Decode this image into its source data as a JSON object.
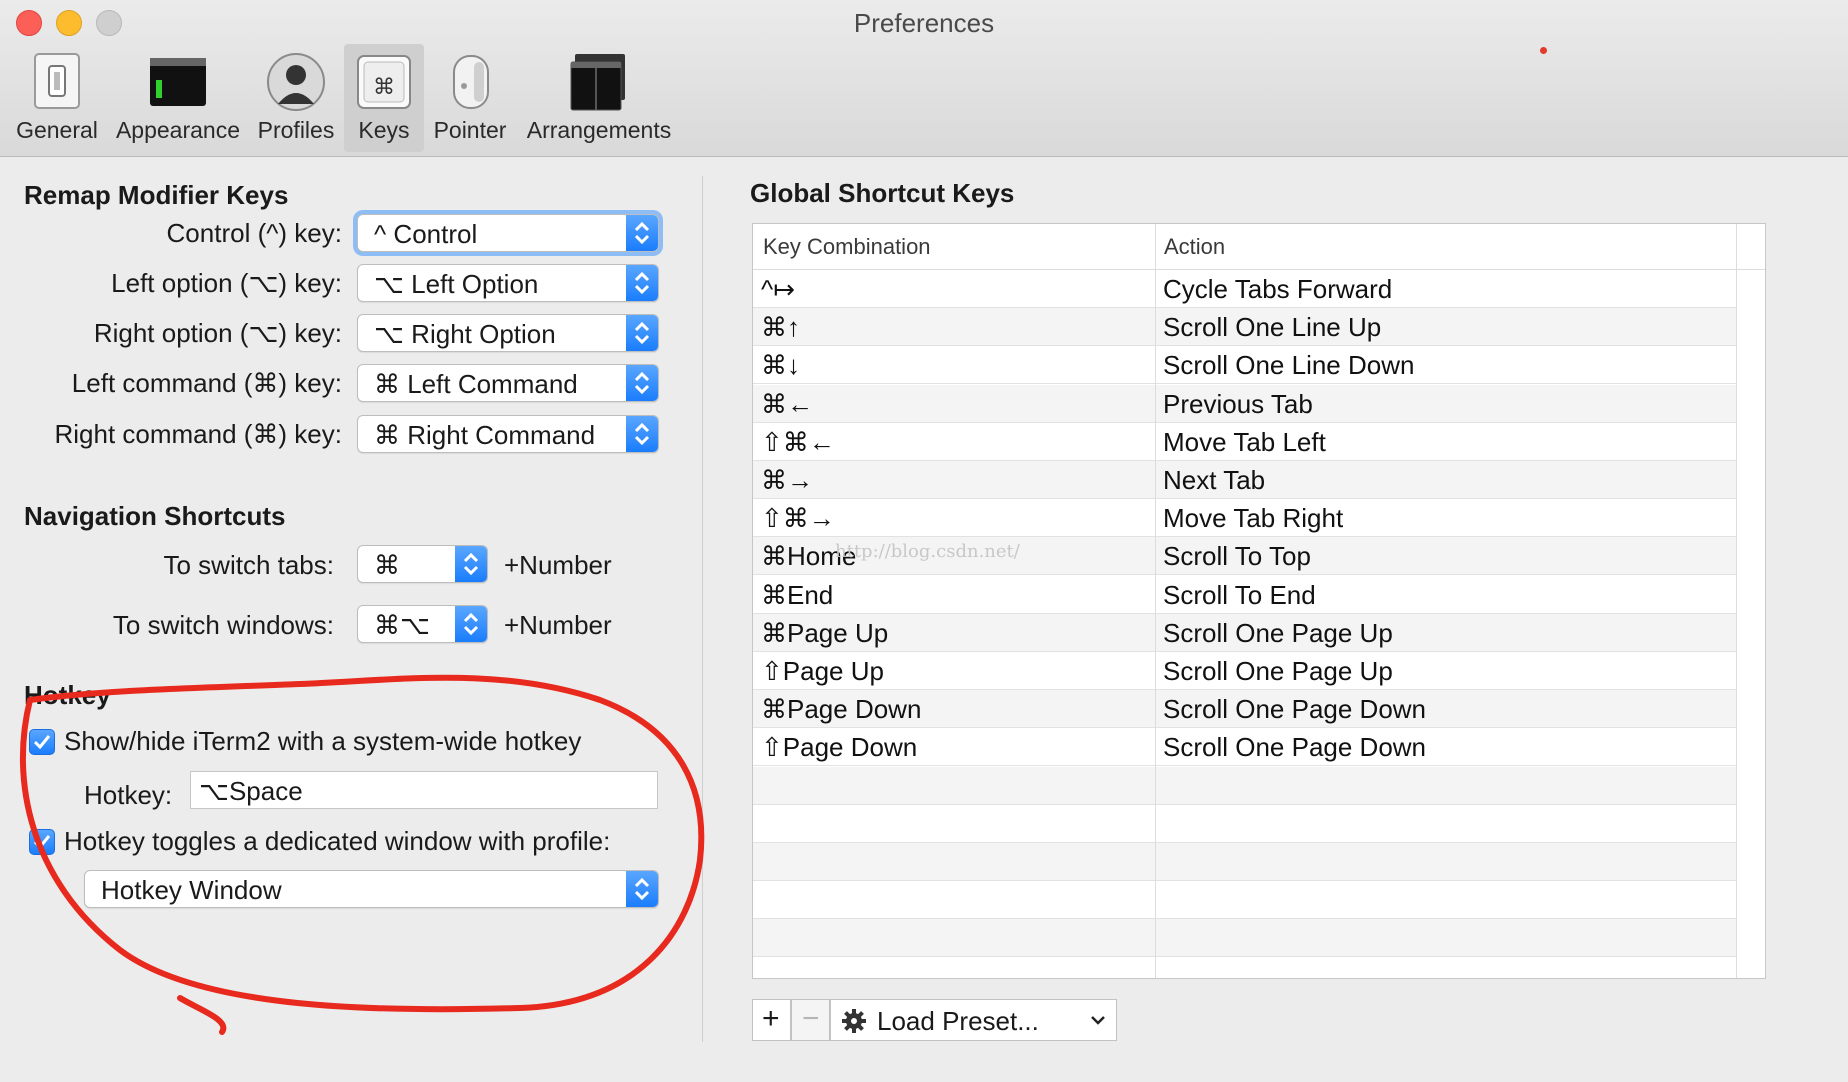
{
  "window": {
    "title": "Preferences"
  },
  "toolbar": {
    "items": [
      {
        "label": "General",
        "icon": "switch-icon"
      },
      {
        "label": "Appearance",
        "icon": "terminal-window-icon"
      },
      {
        "label": "Profiles",
        "icon": "user-icon"
      },
      {
        "label": "Keys",
        "icon": "command-key-icon",
        "selected": true
      },
      {
        "label": "Pointer",
        "icon": "mouse-icon"
      },
      {
        "label": "Arrangements",
        "icon": "windows-icon"
      }
    ]
  },
  "remap": {
    "title": "Remap Modifier Keys",
    "rows": [
      {
        "label": "Control (^) key:",
        "value": "^ Control"
      },
      {
        "label": "Left option (⌥) key:",
        "value": "⌥ Left Option"
      },
      {
        "label": "Right option (⌥) key:",
        "value": "⌥ Right Option"
      },
      {
        "label": "Left command (⌘) key:",
        "value": "⌘ Left Command"
      },
      {
        "label": "Right command (⌘) key:",
        "value": "⌘ Right Command"
      }
    ]
  },
  "navigation": {
    "title": "Navigation Shortcuts",
    "tabs_label": "To switch tabs:",
    "tabs_value": "⌘",
    "windows_label": "To switch windows:",
    "windows_value": "⌘⌥",
    "suffix": "+Number"
  },
  "hotkey": {
    "title": "Hotkey",
    "show_hide_label": "Show/hide iTerm2 with a system-wide hotkey",
    "show_hide_checked": true,
    "hotkey_label": "Hotkey:",
    "hotkey_value": "⌥Space",
    "toggle_label": "Hotkey toggles a dedicated window with profile:",
    "toggle_checked": true,
    "profile_value": "Hotkey Window"
  },
  "global": {
    "title": "Global Shortcut Keys",
    "columns": [
      "Key Combination",
      "Action"
    ],
    "rows": [
      {
        "key": "^↦",
        "action": "Cycle Tabs Forward"
      },
      {
        "key": "⌘↑",
        "action": "Scroll One Line Up"
      },
      {
        "key": "⌘↓",
        "action": "Scroll One Line Down"
      },
      {
        "key": "⌘←",
        "action": "Previous Tab"
      },
      {
        "key": "⇧⌘←",
        "action": "Move Tab Left"
      },
      {
        "key": "⌘→",
        "action": "Next Tab"
      },
      {
        "key": "⇧⌘→",
        "action": "Move Tab Right"
      },
      {
        "key": "⌘Home",
        "action": "Scroll To Top"
      },
      {
        "key": "⌘End",
        "action": "Scroll To End"
      },
      {
        "key": "⌘Page Up",
        "action": "Scroll One Page Up"
      },
      {
        "key": "⇧Page Up",
        "action": "Scroll One Page Up"
      },
      {
        "key": "⌘Page Down",
        "action": "Scroll One Page Down"
      },
      {
        "key": "⇧Page Down",
        "action": "Scroll One Page Down"
      }
    ],
    "add_label": "+",
    "remove_label": "−",
    "preset_label": "Load Preset..."
  },
  "watermark": "http://blog.csdn.net/",
  "colors": {
    "accent": "#1a7dfc",
    "annotation": "#e8291d"
  }
}
